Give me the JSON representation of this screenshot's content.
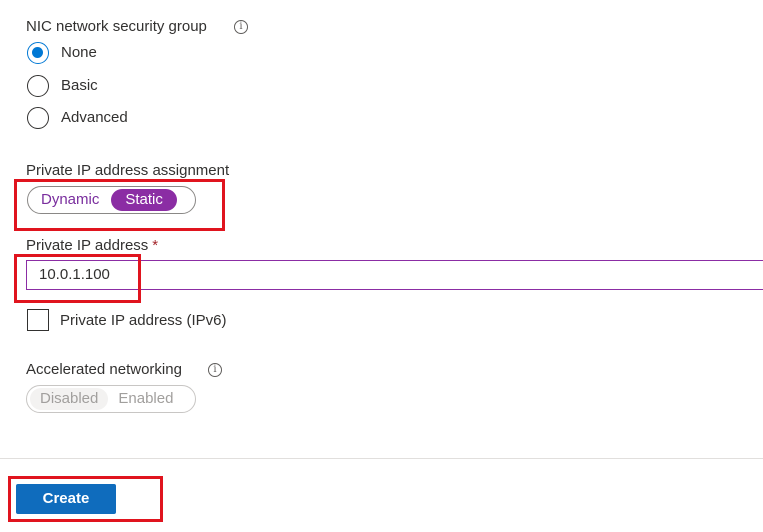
{
  "nsg": {
    "label": "NIC network security group",
    "info_symbol": "i",
    "options": [
      {
        "label": "None",
        "selected": true
      },
      {
        "label": "Basic",
        "selected": false
      },
      {
        "label": "Advanced",
        "selected": false
      }
    ]
  },
  "ip_assignment": {
    "label": "Private IP address assignment",
    "options": [
      "Dynamic",
      "Static"
    ],
    "selected": "Static"
  },
  "private_ip": {
    "label": "Private IP address",
    "required_marker": "*",
    "value": "10.0.1.100"
  },
  "ipv6": {
    "label": "Private IP address (IPv6)",
    "checked": false
  },
  "accelerated_networking": {
    "label": "Accelerated networking",
    "info_symbol": "i",
    "options": [
      "Disabled",
      "Enabled"
    ],
    "selected": "Disabled",
    "disabled": true
  },
  "footer": {
    "create_label": "Create"
  },
  "colors": {
    "accent_blue": "#0078d4",
    "toggle_purple": "#8b2da4",
    "highlight_red": "#e0141e"
  }
}
